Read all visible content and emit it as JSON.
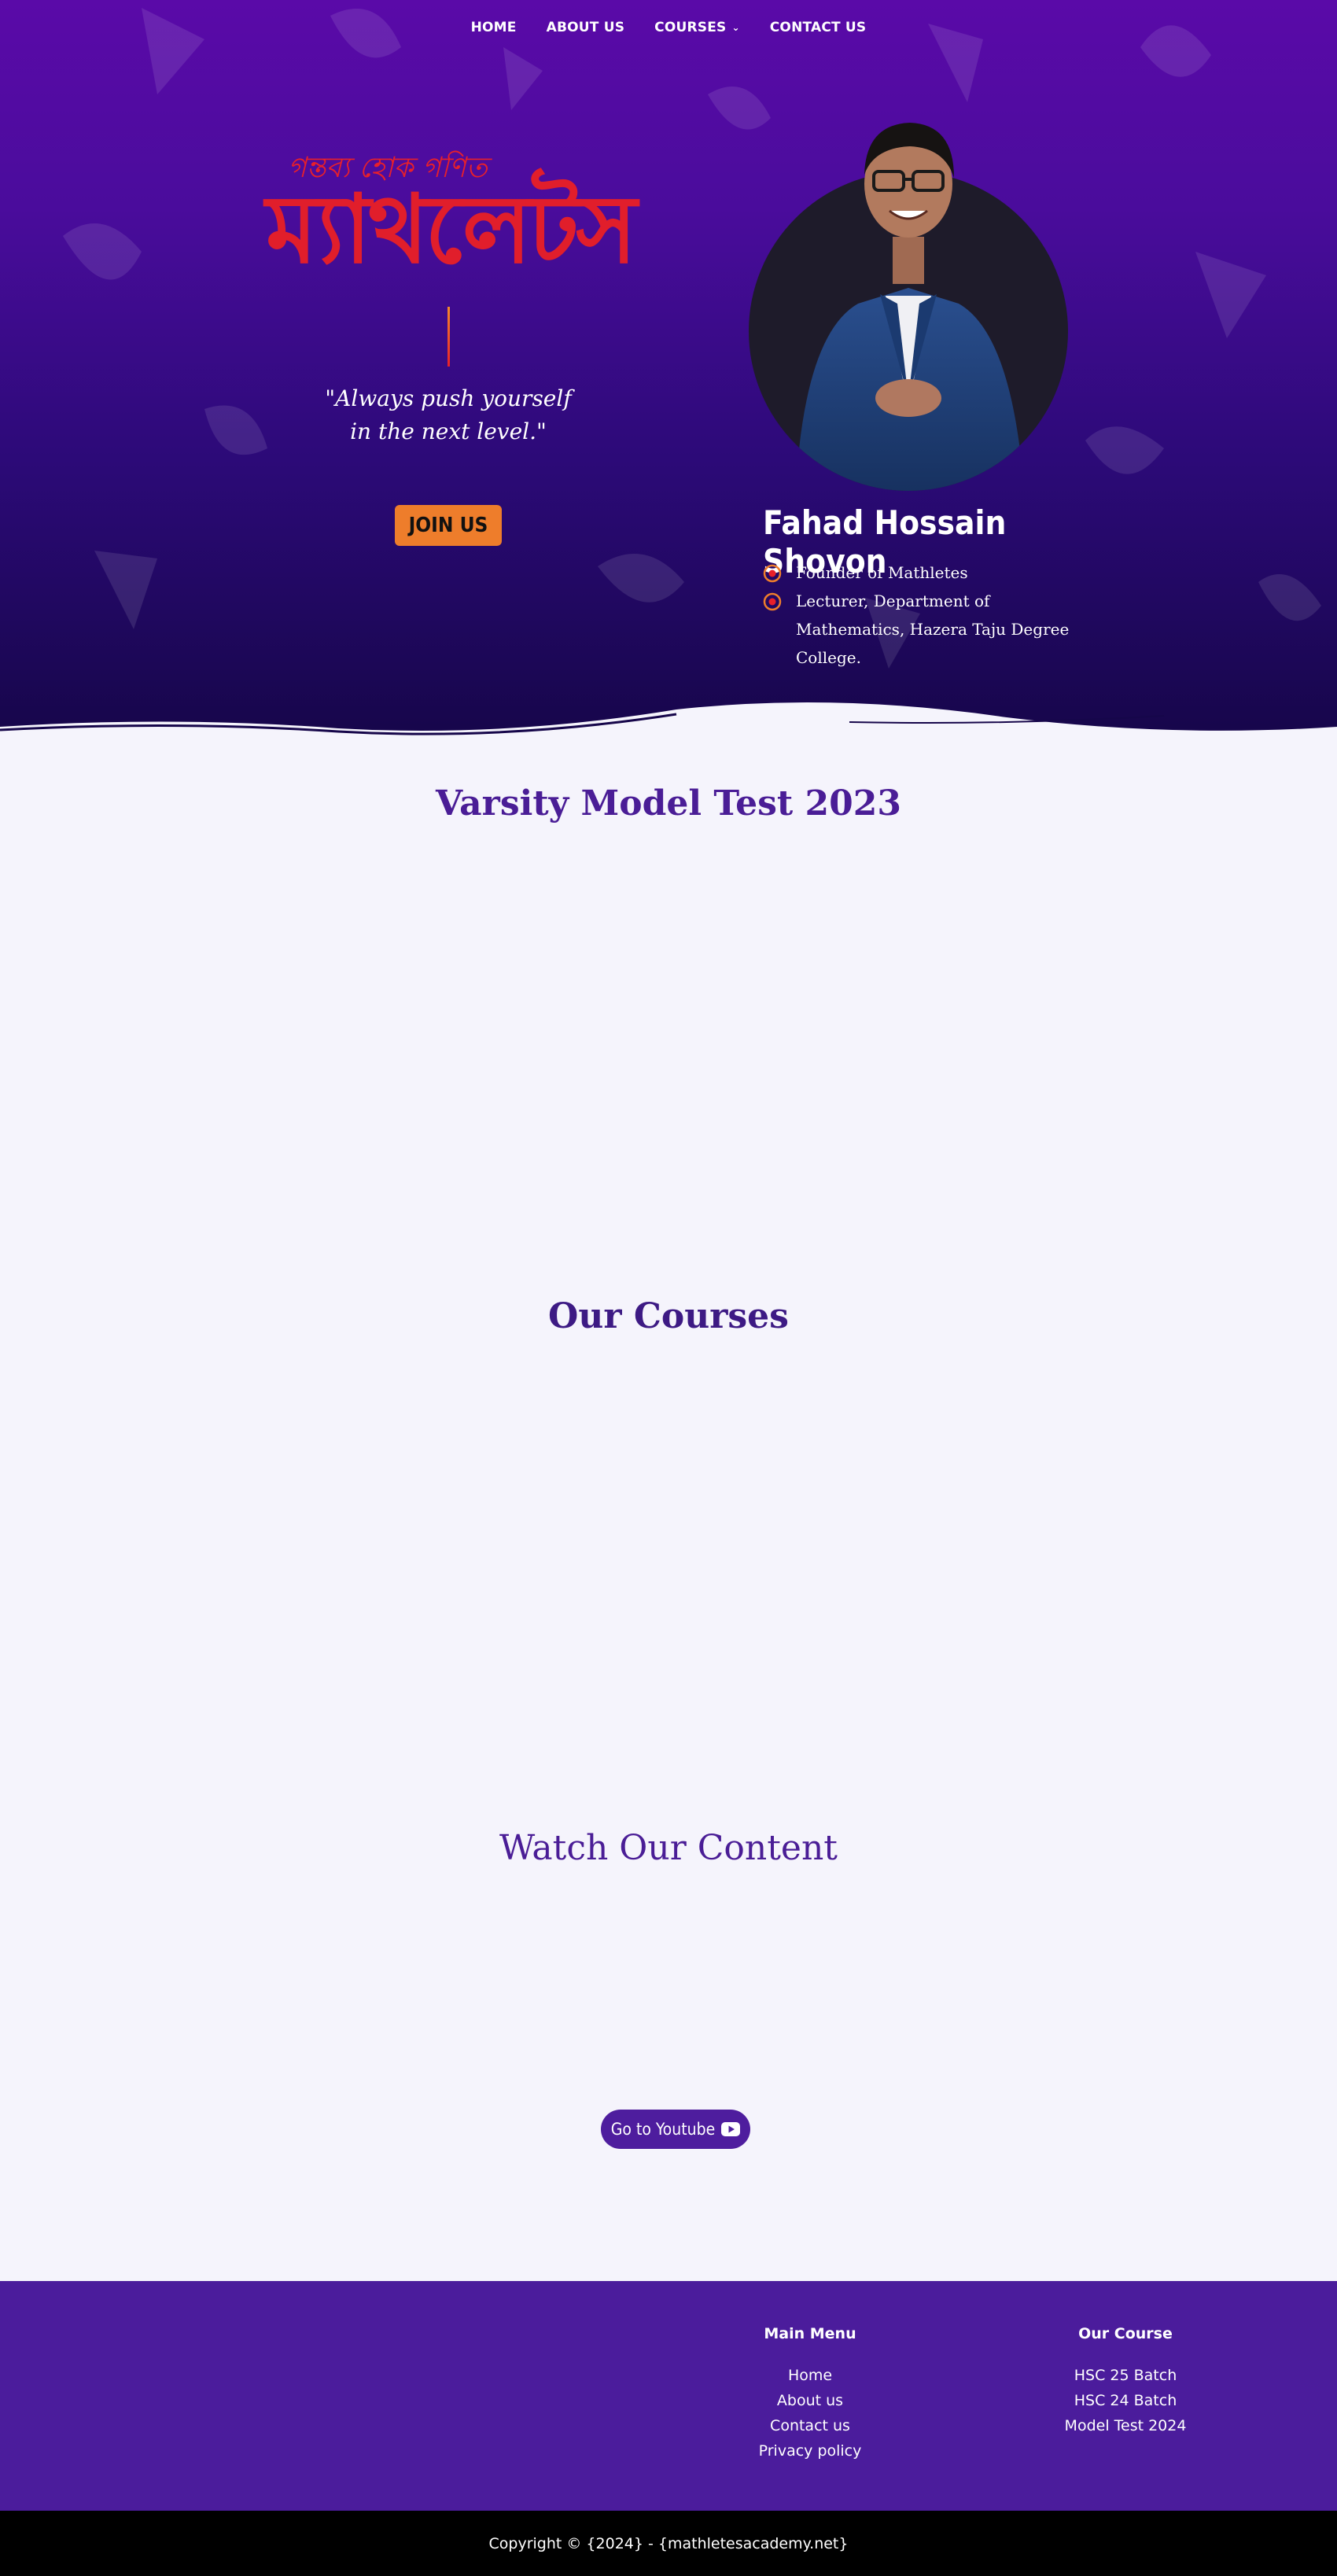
{
  "nav": {
    "items": [
      {
        "label": "HOME"
      },
      {
        "label": "ABOUT US"
      },
      {
        "label": "COURSES"
      },
      {
        "label": "CONTACT US"
      }
    ]
  },
  "hero": {
    "tagline": "গন্তব্য হোক গণিত",
    "brand": "ম্যাথলেটস",
    "quote_line1": "\"Always push yourself",
    "quote_line2": "in the next level.\"",
    "join_label": "JOIN US",
    "person_name": "Fahad Hossain Shovon",
    "roles": [
      "Founder of Mathletes",
      "Lecturer, Department of Mathematics, Hazera Taju Degree College."
    ]
  },
  "sections": {
    "model_test_title": "Varsity Model Test 2023",
    "courses_title": "Our Courses",
    "content_title": "Watch Our Content",
    "youtube_label": "Go to Youtube"
  },
  "footer": {
    "main_menu": {
      "title": "Main Menu",
      "links": [
        "Home",
        "About us",
        "Contact us",
        "Privacy policy"
      ]
    },
    "our_course": {
      "title": "Our Course",
      "links": [
        "HSC 25 Batch",
        "HSC 24 Batch",
        "Model Test 2024"
      ]
    },
    "copyright": "Copyright © {2024} - {mathletesacademy.net}"
  },
  "colors": {
    "brand_red": "#e11e2b",
    "accent_orange": "#ee7d2b",
    "purple": "#4b1c9c",
    "hero_top": "#5a0aa8",
    "hero_bottom": "#16064a"
  }
}
